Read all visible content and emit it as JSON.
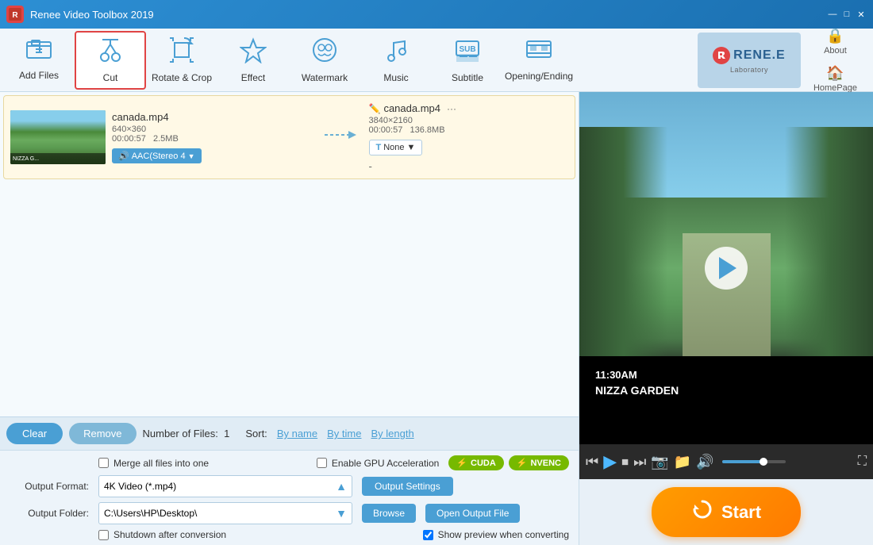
{
  "app": {
    "title": "Renee Video Toolbox 2019",
    "logo_text": "R"
  },
  "title_bar": {
    "minimize": "—",
    "maximize": "□",
    "close": "✕"
  },
  "toolbar": {
    "add_files": "Add Files",
    "cut": "Cut",
    "rotate_crop": "Rotate & Crop",
    "effect": "Effect",
    "watermark": "Watermark",
    "music": "Music",
    "subtitle": "Subtitle",
    "opening_ending": "Opening/Ending",
    "about": "About",
    "homepage": "HomePage"
  },
  "file_item": {
    "input_name": "canada.mp4",
    "input_dim": "640×360",
    "input_duration": "00:00:57",
    "input_size": "2.5MB",
    "output_name": "canada.mp4",
    "output_dim": "3840×2160",
    "output_duration": "00:00:57",
    "output_size": "136.8MB",
    "audio_track": "AAC(Stereo 4",
    "subtitle": "None",
    "dash": "-"
  },
  "bottom_bar": {
    "clear": "Clear",
    "remove": "Remove",
    "file_count_label": "Number of Files:",
    "file_count": "1",
    "sort_label": "Sort:",
    "sort_by_name": "By name",
    "sort_by_time": "By time",
    "sort_by_length": "By length"
  },
  "settings": {
    "output_format_label": "Output Format:",
    "output_format_value": "4K Video (*.mp4)",
    "output_settings_btn": "Output Settings",
    "output_folder_label": "Output Folder:",
    "output_folder_value": "C:\\Users\\HP\\Desktop\\",
    "browse_btn": "Browse",
    "open_output_btn": "Open Output File",
    "merge_label": "Merge all files into one",
    "gpu_label": "Enable GPU Acceleration",
    "cuda_label": "CUDA",
    "nvenc_label": "NVENC",
    "shutdown_label": "Shutdown after conversion",
    "preview_label": "Show preview when converting"
  },
  "video_overlay": {
    "time": "11:30AM",
    "location": "NIZZA GARDEN"
  },
  "start_btn": "Start",
  "colors": {
    "accent": "#4a9fd4",
    "start_btn": "#ff8800",
    "active_border": "#e04444"
  }
}
